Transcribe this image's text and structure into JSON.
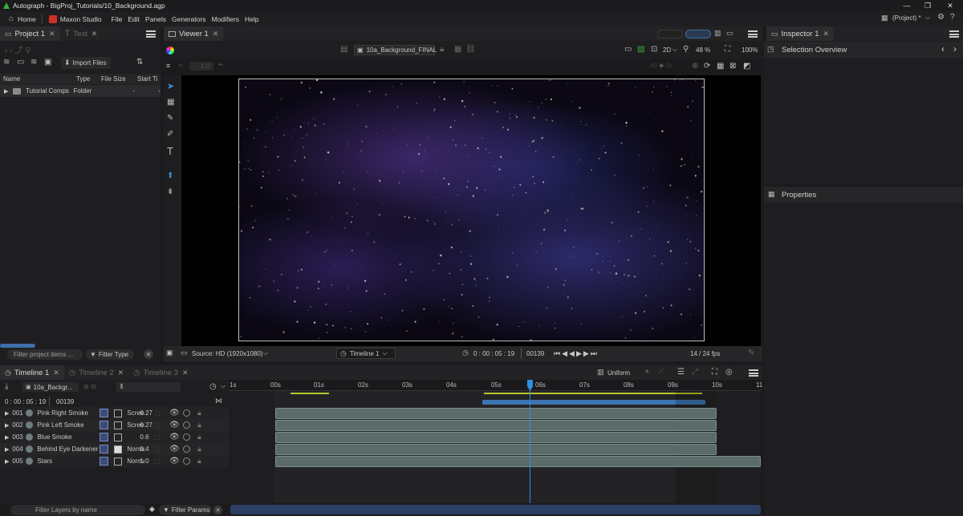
{
  "app": {
    "title": "Autograph - BigProj_Tutorials/10_Background.agp"
  },
  "window_controls": {
    "minimize": "—",
    "maximize": "❐",
    "close": "✕"
  },
  "menu": {
    "home": "Home",
    "studio": "Maxon Studio",
    "items": [
      "File",
      "Edit",
      "Panels",
      "Generators",
      "Modifiers",
      "Help"
    ],
    "project_selector": "(Project) *"
  },
  "project_panel": {
    "tabs": [
      {
        "label": "Project 1",
        "active": true
      },
      {
        "label": "Text",
        "active": false
      }
    ],
    "import_label": "Import Files",
    "columns": [
      "Name",
      "Type",
      "File Size",
      "Start Ti"
    ],
    "rows": [
      {
        "name": "Tutorial Comps",
        "type": "Folder",
        "size": "-",
        "start": "-"
      }
    ],
    "filter_placeholder": "Filter project items ...",
    "filter_type": "Filter Type"
  },
  "viewer": {
    "tab": "Viewer 1",
    "comp_name": "10a_Background_FINAL",
    "mode": "2D",
    "zoom": "48 %",
    "zoom_fit": "100%",
    "small_field": "1.0",
    "source": "Source: HD (1920x1080)",
    "timeline_select": "Timeline 1",
    "timecode": "0 : 00 : 05 : 19",
    "frame": "00139",
    "fps": "14 / 24 fps"
  },
  "inspector": {
    "tab": "Inspector 1",
    "selection": "Selection Overview",
    "properties": "Properties"
  },
  "timeline": {
    "tabs": [
      {
        "label": "Timeline 1",
        "active": true
      },
      {
        "label": "Timeline 2",
        "active": false
      },
      {
        "label": "Timeline 3",
        "active": false
      }
    ],
    "comp_short": "10a_Backgr...",
    "uniform": "Uniform",
    "timecode": "0 : 00 : 05 : 19",
    "frame": "00139",
    "ruler": [
      "1s",
      "00s",
      "01s",
      "02s",
      "03s",
      "04s",
      "05s",
      "06s",
      "07s",
      "08s",
      "09s",
      "10s",
      "11"
    ],
    "layers": [
      {
        "num": "001",
        "name": "Pink Right Smoke",
        "blend": "Screen",
        "opacity": "0.27"
      },
      {
        "num": "002",
        "name": "Pink Left Smoke",
        "blend": "Screen",
        "opacity": "0.27"
      },
      {
        "num": "003",
        "name": "Blue Smoke",
        "blend": "",
        "opacity": "0.6"
      },
      {
        "num": "004",
        "name": "Behind Eye Darkener",
        "blend": "Normal",
        "opacity": "0.4"
      },
      {
        "num": "005",
        "name": "Stars",
        "blend": "Normal",
        "opacity": "1.0"
      }
    ],
    "filter_layers_placeholder": "Filter Layers by name",
    "filter_params": "Filter Params"
  },
  "colors": {
    "accent": "#3a7fd5",
    "playhead": "#2f8fe0",
    "clip": "#5b6b6a",
    "marker": "#b4c82a"
  }
}
